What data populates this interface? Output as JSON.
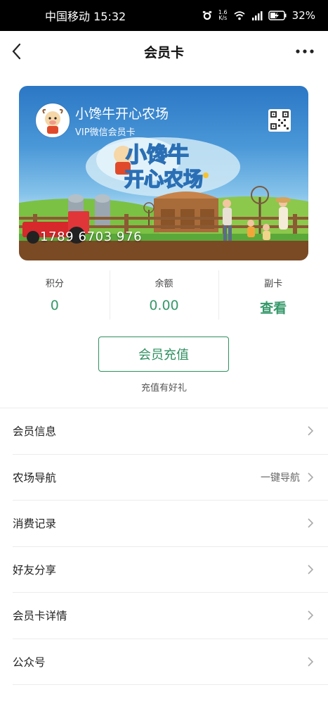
{
  "status_bar": {
    "carrier_time": "中国移动 15:32",
    "net_speed_value": "1.6",
    "net_speed_unit": "K/s",
    "battery": "32%"
  },
  "navbar": {
    "title": "会员卡"
  },
  "card": {
    "name": "小馋牛开心农场",
    "subtitle": "VIP微信会员卡",
    "art_title_line1": "小馋牛",
    "art_title_line2": "开心农场",
    "number": "1789 6703 976"
  },
  "stats": [
    {
      "label": "积分",
      "value": "0"
    },
    {
      "label": "余额",
      "value": "0.00"
    },
    {
      "label": "副卡",
      "value": "查看"
    }
  ],
  "recharge": {
    "button_label": "会员充值",
    "tip": "充值有好礼"
  },
  "menu": [
    {
      "label": "会员信息",
      "extra": ""
    },
    {
      "label": "农场导航",
      "extra": "一键导航"
    },
    {
      "label": "消费记录",
      "extra": ""
    },
    {
      "label": "好友分享",
      "extra": ""
    },
    {
      "label": "会员卡详情",
      "extra": ""
    },
    {
      "label": "公众号",
      "extra": ""
    }
  ],
  "colors": {
    "accent": "#2e8f5f",
    "value_green": "#36986a"
  },
  "icons": [
    "back-arrow-icon",
    "more-dots-icon",
    "alarm-icon",
    "wifi-icon",
    "signal-icon",
    "battery-icon",
    "qr-code-icon",
    "chevron-right-icon"
  ]
}
